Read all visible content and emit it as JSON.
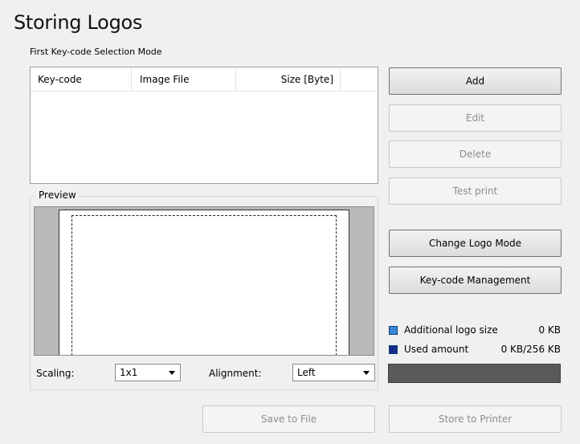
{
  "title": "Storing Logos",
  "subtitle": "First Key-code Selection Mode",
  "list": {
    "columns": [
      "Key-code",
      "Image File",
      "Size [Byte]"
    ],
    "rows": []
  },
  "preview": {
    "label": "Preview",
    "scaling_label": "Scaling:",
    "scaling_value": "1x1",
    "alignment_label": "Alignment:",
    "alignment_value": "Left"
  },
  "buttons": {
    "add": "Add",
    "edit": "Edit",
    "delete": "Delete",
    "test_print": "Test print",
    "change_logo_mode": "Change Logo Mode",
    "keycode_management": "Key-code Management",
    "save_to_file": "Save to File",
    "store_to_printer": "Store to Printer"
  },
  "capacity": {
    "additional_label": "Additional logo size",
    "additional_value": "0 KB",
    "used_label": "Used amount",
    "used_value": "0 KB/256 KB",
    "additional_color": "#3a87d6",
    "used_color": "#1a2a8a",
    "used_fraction": 0
  }
}
